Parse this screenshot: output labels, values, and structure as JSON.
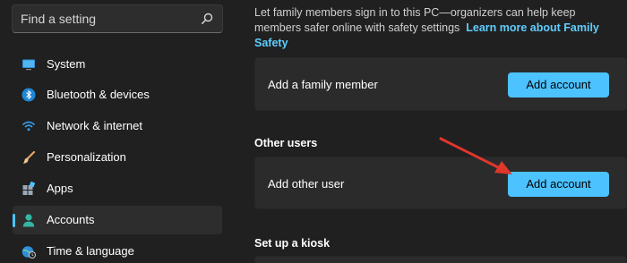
{
  "search": {
    "placeholder": "Find a setting",
    "icon": "search-icon"
  },
  "sidebar": {
    "items": [
      {
        "label": "System",
        "icon": "system-display-icon",
        "active": false
      },
      {
        "label": "Bluetooth & devices",
        "icon": "bluetooth-icon",
        "active": false
      },
      {
        "label": "Network & internet",
        "icon": "wifi-icon",
        "active": false
      },
      {
        "label": "Personalization",
        "icon": "brush-icon",
        "active": false
      },
      {
        "label": "Apps",
        "icon": "apps-icon",
        "active": false
      },
      {
        "label": "Accounts",
        "icon": "person-icon",
        "active": true
      },
      {
        "label": "Time & language",
        "icon": "globe-clock-icon",
        "active": false
      }
    ],
    "accent": "#4cc2ff"
  },
  "main": {
    "intro_text": "Let family members sign in to this PC—organizers can help keep members safer online with safety settings",
    "intro_link": "Learn more about Family Safety",
    "family_card": {
      "label": "Add a family member",
      "button": "Add account"
    },
    "other_users": {
      "heading": "Other users",
      "label": "Add other user",
      "button": "Add account"
    },
    "kiosk": {
      "heading": "Set up a kiosk"
    }
  },
  "colors": {
    "background": "#202020",
    "card": "#2b2b2b",
    "accent": "#4cc2ff",
    "link": "#60cdff",
    "annotation_arrow": "#e0362c"
  }
}
